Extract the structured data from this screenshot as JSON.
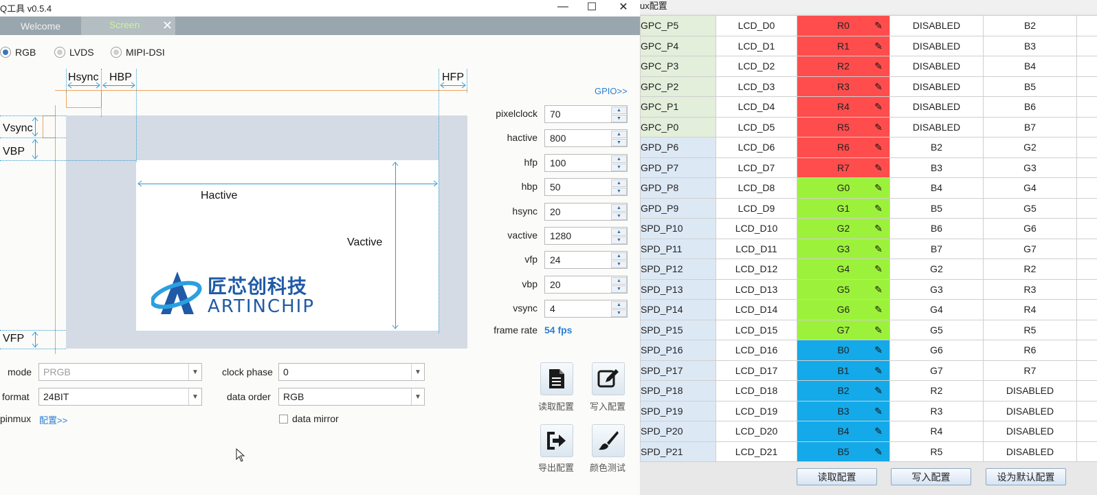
{
  "window": {
    "title": "Q工具 v0.5.4",
    "controls": {
      "minimize": "—",
      "maximize": "☐",
      "close": "✕"
    }
  },
  "tabs": [
    {
      "label": "Welcome",
      "active": false
    },
    {
      "label": "Screen",
      "active": true
    }
  ],
  "tab_close": "✕",
  "interface": {
    "options": [
      "RGB",
      "LVDS",
      "MIPI-DSI"
    ],
    "selected": "RGB"
  },
  "diagram": {
    "labels": {
      "hsync": "Hsync",
      "hbp": "HBP",
      "hfp": "HFP",
      "vsync": "Vsync",
      "vbp": "VBP",
      "vfp": "VFP",
      "hactive": "Hactive",
      "vactive": "Vactive"
    },
    "logo": {
      "cn": "匠芯创科技",
      "en": "ARTINCHIP"
    }
  },
  "gpio_link": "GPIO>>",
  "params": [
    {
      "label": "pixelclock",
      "value": "70"
    },
    {
      "label": "hactive",
      "value": "800"
    },
    {
      "label": "hfp",
      "value": "100"
    },
    {
      "label": "hbp",
      "value": "50"
    },
    {
      "label": "hsync",
      "value": "20"
    },
    {
      "label": "vactive",
      "value": "1280"
    },
    {
      "label": "vfp",
      "value": "24"
    },
    {
      "label": "vbp",
      "value": "20"
    },
    {
      "label": "vsync",
      "value": "4"
    }
  ],
  "frame_rate": {
    "label": "frame rate",
    "value": "54 fps"
  },
  "form": {
    "mode": {
      "label": "mode",
      "value": "PRGB"
    },
    "format": {
      "label": "format",
      "value": "24BIT"
    },
    "pinmux": {
      "label": "pinmux",
      "link": "配置>>"
    },
    "clock_phase": {
      "label": "clock phase",
      "value": "0"
    },
    "data_order": {
      "label": "data order",
      "value": "RGB"
    },
    "data_mirror": {
      "label": "data mirror",
      "checked": false
    }
  },
  "toolbar": {
    "read": "读取配置",
    "write": "写入配置",
    "export": "导出配置",
    "color_test": "颜色测试"
  },
  "pinmux_panel": {
    "title": "ux配置",
    "rows": [
      {
        "pin": "GPC_P5",
        "signal": "LCD_D0",
        "func": "R0",
        "a": "DISABLED",
        "b": "B2",
        "group": "gpc",
        "color": "#ff4d4d"
      },
      {
        "pin": "GPC_P4",
        "signal": "LCD_D1",
        "func": "R1",
        "a": "DISABLED",
        "b": "B3",
        "group": "gpc",
        "color": "#ff4d4d"
      },
      {
        "pin": "GPC_P3",
        "signal": "LCD_D2",
        "func": "R2",
        "a": "DISABLED",
        "b": "B4",
        "group": "gpc",
        "color": "#ff4d4d"
      },
      {
        "pin": "GPC_P2",
        "signal": "LCD_D3",
        "func": "R3",
        "a": "DISABLED",
        "b": "B5",
        "group": "gpc",
        "color": "#ff4d4d"
      },
      {
        "pin": "GPC_P1",
        "signal": "LCD_D4",
        "func": "R4",
        "a": "DISABLED",
        "b": "B6",
        "group": "gpc",
        "color": "#ff4d4d"
      },
      {
        "pin": "GPC_P0",
        "signal": "LCD_D5",
        "func": "R5",
        "a": "DISABLED",
        "b": "B7",
        "group": "gpc",
        "color": "#ff4d4d"
      },
      {
        "pin": "GPD_P6",
        "signal": "LCD_D6",
        "func": "R6",
        "a": "B2",
        "b": "G2",
        "group": "gpd",
        "color": "#ff4d4d"
      },
      {
        "pin": "GPD_P7",
        "signal": "LCD_D7",
        "func": "R7",
        "a": "B3",
        "b": "G3",
        "group": "gpd",
        "color": "#ff4d4d"
      },
      {
        "pin": "GPD_P8",
        "signal": "LCD_D8",
        "func": "G0",
        "a": "B4",
        "b": "G4",
        "group": "gpd",
        "color": "#9cf23a"
      },
      {
        "pin": "GPD_P9",
        "signal": "LCD_D9",
        "func": "G1",
        "a": "B5",
        "b": "G5",
        "group": "gpd",
        "color": "#9cf23a"
      },
      {
        "pin": "SPD_P10",
        "signal": "LCD_D10",
        "func": "G2",
        "a": "B6",
        "b": "G6",
        "group": "gpd",
        "color": "#9cf23a"
      },
      {
        "pin": "SPD_P11",
        "signal": "LCD_D11",
        "func": "G3",
        "a": "B7",
        "b": "G7",
        "group": "gpd",
        "color": "#9cf23a"
      },
      {
        "pin": "SPD_P12",
        "signal": "LCD_D12",
        "func": "G4",
        "a": "G2",
        "b": "R2",
        "group": "gpd",
        "color": "#9cf23a"
      },
      {
        "pin": "SPD_P13",
        "signal": "LCD_D13",
        "func": "G5",
        "a": "G3",
        "b": "R3",
        "group": "gpd",
        "color": "#9cf23a"
      },
      {
        "pin": "SPD_P14",
        "signal": "LCD_D14",
        "func": "G6",
        "a": "G4",
        "b": "R4",
        "group": "gpd",
        "color": "#9cf23a"
      },
      {
        "pin": "SPD_P15",
        "signal": "LCD_D15",
        "func": "G7",
        "a": "G5",
        "b": "R5",
        "group": "gpd",
        "color": "#9cf23a"
      },
      {
        "pin": "SPD_P16",
        "signal": "LCD_D16",
        "func": "B0",
        "a": "G6",
        "b": "R6",
        "group": "gpd",
        "color": "#14a9e8"
      },
      {
        "pin": "SPD_P17",
        "signal": "LCD_D17",
        "func": "B1",
        "a": "G7",
        "b": "R7",
        "group": "gpd",
        "color": "#14a9e8"
      },
      {
        "pin": "SPD_P18",
        "signal": "LCD_D18",
        "func": "B2",
        "a": "R2",
        "b": "DISABLED",
        "group": "gpd",
        "color": "#14a9e8"
      },
      {
        "pin": "SPD_P19",
        "signal": "LCD_D19",
        "func": "B3",
        "a": "R3",
        "b": "DISABLED",
        "group": "gpd",
        "color": "#14a9e8"
      },
      {
        "pin": "SPD_P20",
        "signal": "LCD_D20",
        "func": "B4",
        "a": "R4",
        "b": "DISABLED",
        "group": "gpd",
        "color": "#14a9e8"
      },
      {
        "pin": "SPD_P21",
        "signal": "LCD_D21",
        "func": "B5",
        "a": "R5",
        "b": "DISABLED",
        "group": "gpd",
        "color": "#14a9e8"
      }
    ],
    "buttons": {
      "read": "读取配置",
      "write": "写入配置",
      "default": "设为默认配置"
    }
  },
  "icons": {
    "edit": "pencil-icon",
    "read": "document-icon",
    "write": "edit-form-icon",
    "export": "export-icon",
    "color_test": "brush-icon",
    "cursor": "mouse-cursor-icon"
  },
  "colors": {
    "tabbar": "#99a6ad",
    "active_tab_text": "#c8f59a",
    "link": "#2a7fd4",
    "red_func": "#ff4d4d",
    "green_func": "#9cf23a",
    "blue_func": "#14a9e8",
    "diagram_grey": "#d5dbe4",
    "timing_orange": "#f0a35a"
  }
}
